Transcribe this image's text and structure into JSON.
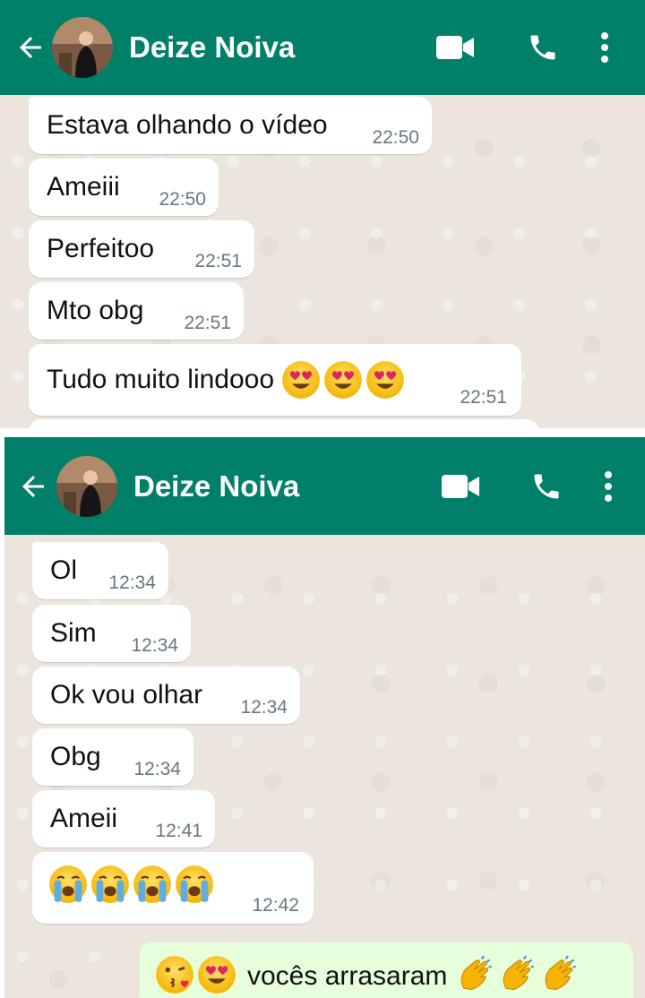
{
  "top": {
    "contact_name": "Deize Noiva",
    "messages": [
      {
        "text": "Estava olhando o vídeo",
        "time": "22:50"
      },
      {
        "text": "Ameiii",
        "time": "22:50"
      },
      {
        "text": "Perfeitoo",
        "time": "22:51"
      },
      {
        "text": "Mto obg",
        "time": "22:51"
      },
      {
        "text": "Tudo muito lindooo",
        "time": "22:51",
        "emojis": [
          "heart-eyes-emoji",
          "heart-eyes-emoji",
          "heart-eyes-emoji"
        ]
      }
    ]
  },
  "bottom": {
    "contact_name": "Deize Noiva",
    "messages": [
      {
        "text": "Ol",
        "time": "12:34"
      },
      {
        "text": "Sim",
        "time": "12:34"
      },
      {
        "text": "Ok vou olhar",
        "time": "12:34"
      },
      {
        "text": "Obg",
        "time": "12:34"
      },
      {
        "text": "Ameii",
        "time": "12:41"
      },
      {
        "text": "",
        "time": "12:42",
        "emojis": [
          "crying-emoji",
          "crying-emoji",
          "crying-emoji",
          "crying-emoji"
        ]
      }
    ],
    "outgoing": {
      "text": "vocês arrasaram",
      "emojis_before": [
        "kiss-emoji",
        "heart-eyes-emoji"
      ],
      "emojis_after": [
        "clapping-emoji",
        "clapping-emoji",
        "clapping-emoji"
      ]
    }
  },
  "icons": [
    "back-arrow-icon",
    "video-call-icon",
    "phone-icon",
    "more-options-icon"
  ],
  "colors": {
    "header": "#008069",
    "chat_bg": "#ece5dd",
    "incoming_bubble": "#ffffff",
    "outgoing_bubble": "#e7ffdb",
    "timestamp": "#667781"
  }
}
